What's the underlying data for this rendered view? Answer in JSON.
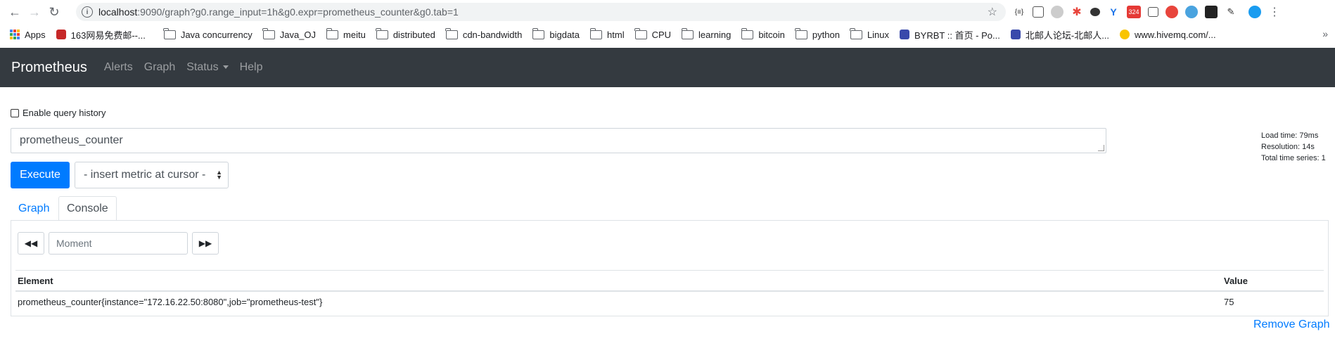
{
  "browser": {
    "url_host": "localhost",
    "url_rest": ":9090/graph?g0.range_input=1h&g0.expr=prometheus_counter&g0.tab=1",
    "extension_badge": "324",
    "bookmarks": [
      {
        "label": "Apps",
        "icon": "apps-grid-icon"
      },
      {
        "label": "163网易免费邮--...",
        "icon": "mail-163-icon"
      },
      {
        "label": "Java concurrency",
        "icon": "folder-icon"
      },
      {
        "label": "Java_OJ",
        "icon": "folder-icon"
      },
      {
        "label": "meitu",
        "icon": "folder-icon"
      },
      {
        "label": "distributed",
        "icon": "folder-icon"
      },
      {
        "label": "cdn-bandwidth",
        "icon": "folder-icon"
      },
      {
        "label": "bigdata",
        "icon": "folder-icon"
      },
      {
        "label": "html",
        "icon": "folder-icon"
      },
      {
        "label": "CPU",
        "icon": "folder-icon"
      },
      {
        "label": "learning",
        "icon": "folder-icon"
      },
      {
        "label": "bitcoin",
        "icon": "folder-icon"
      },
      {
        "label": "python",
        "icon": "folder-icon"
      },
      {
        "label": "Linux",
        "icon": "folder-icon"
      },
      {
        "label": "BYRBT :: 首页 - Po...",
        "icon": "byrbt-icon"
      },
      {
        "label": "北邮人论坛-北邮人...",
        "icon": "byr-icon"
      },
      {
        "label": "www.hivemq.com/...",
        "icon": "hivemq-icon"
      }
    ],
    "more": "»"
  },
  "navbar": {
    "brand": "Prometheus",
    "alerts": "Alerts",
    "graph": "Graph",
    "status": "Status",
    "help": "Help"
  },
  "query": {
    "history_label": "Enable query history",
    "expression": "prometheus_counter",
    "execute": "Execute",
    "insert_metric": "- insert metric at cursor -",
    "stats": {
      "load_time": "Load time: 79ms",
      "resolution": "Resolution: 14s",
      "total_series": "Total time series: 1"
    }
  },
  "tabs": {
    "graph": "Graph",
    "console": "Console"
  },
  "console": {
    "moment_placeholder": "Moment",
    "headers": {
      "element": "Element",
      "value": "Value"
    },
    "rows": [
      {
        "element": "prometheus_counter{instance=\"172.16.22.50:8080\",job=\"prometheus-test\"}",
        "value": "75"
      }
    ]
  },
  "remove_graph": "Remove Graph",
  "colors": {
    "navbar_bg": "#343a40",
    "primary": "#007bff"
  }
}
